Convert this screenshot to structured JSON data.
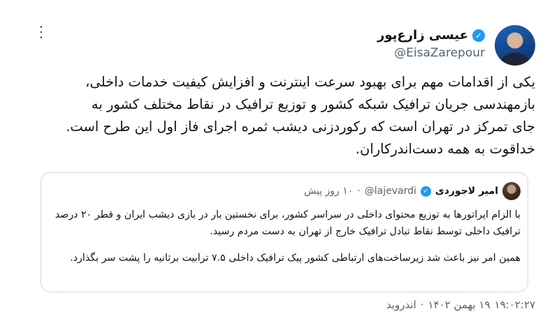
{
  "tweet": {
    "display_name": "عیسی زارع‌پور",
    "handle": "@EisaZarepour",
    "verified_mark": "✓",
    "more_icon": "⋮",
    "text": "یکی از اقدامات مهم برای بهبود سرعت اینترنت و افزایش کیفیت خدمات داخلی،\nبازمهندسی جریان ترافیک شبکه کشور  و توزیع ترافیک در نقاط مختلف کشور به\nجای تمرکز در تهران است که رکوردزنی دیشب ثمره اجرای فاز اول این طرح است.\nخداقوت به همه دست‌اندرکاران.",
    "time": "۱۹:۰۲:۲۷",
    "date": "۱۹ بهمن ۱۴۰۲",
    "platform": "اندروید"
  },
  "quoted": {
    "display_name": "امیر لاجوردی",
    "handle": "@lajevardi",
    "age": "۱۰ روز پیش",
    "separator": "·",
    "verified_mark": "✓",
    "paragraph_1": "با الزام اپراتورها به توزیع محتوای داخلی در سراسر کشور، برای نخستین بار در بازی دیشب ایران و قطر ۲۰ درصد ترافیک داخلی توسط نقاط تبادل ترافیک خارج از تهران به دست مردم رسید.",
    "paragraph_2": "همین امر نیز باعث شد زیرساخت‌های ارتباطی کشور پیک ترافیک داخلی ۷.۵ ترابیت برثانیه را  پشت سر بگذارد."
  }
}
